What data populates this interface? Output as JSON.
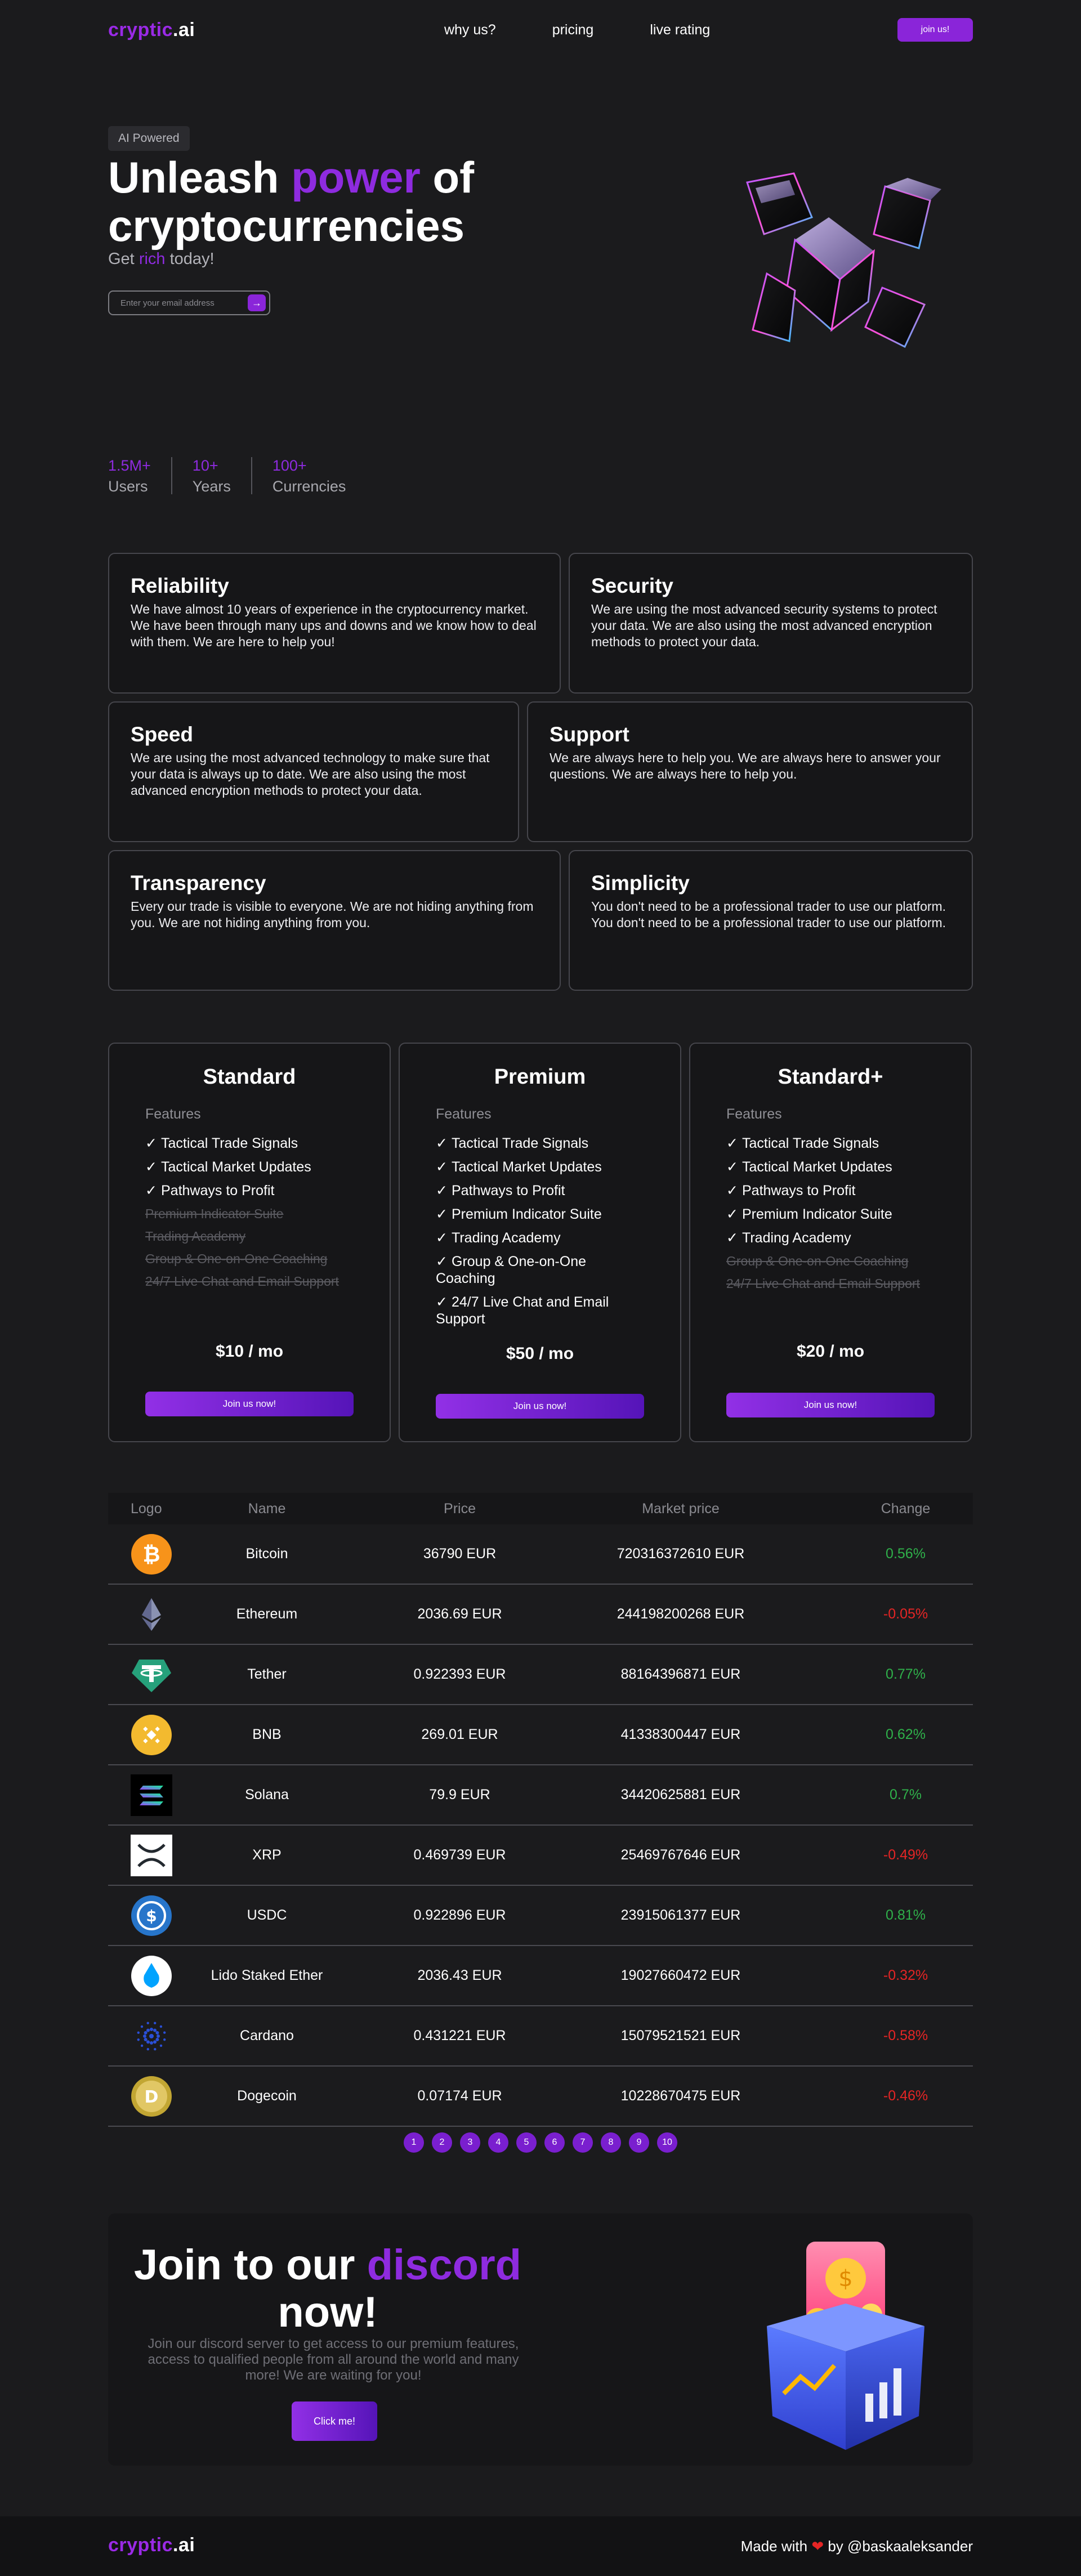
{
  "nav": {
    "logo_part1": "cryptic",
    "logo_part2": ".ai",
    "links": [
      "why us?",
      "pricing",
      "live rating"
    ],
    "join_label": "join us!"
  },
  "hero": {
    "badge": "AI Powered",
    "title_pre": "Unleash ",
    "title_accent": "power",
    "title_post": " of cryptocurrencies",
    "subtitle_pre": "Get ",
    "subtitle_accent": "rich",
    "subtitle_post": " today!",
    "email_placeholder": "Enter your email address",
    "stats": [
      {
        "value": "1.5M+",
        "label": "Users"
      },
      {
        "value": "10+",
        "label": "Years"
      },
      {
        "value": "100+",
        "label": "Currencies"
      }
    ]
  },
  "features": [
    {
      "title": "Reliability",
      "text": "We have almost 10 years of experience in the cryptocurrency market. We have been through many ups and downs and we know how to deal with them. We are here to help you!"
    },
    {
      "title": "Security",
      "text": "We are using the most advanced security systems to protect your data. We are also using the most advanced encryption methods to protect your data."
    },
    {
      "title": "Speed",
      "text": "We are using the most advanced technology to make sure that your data is always up to date. We are also using the most advanced encryption methods to protect your data."
    },
    {
      "title": "Support",
      "text": "We are always here to help you. We are always here to answer your questions. We are always here to help you."
    },
    {
      "title": "Transparency",
      "text": "Every our trade is visible to everyone. We are not hiding anything from you. We are not hiding anything from you."
    },
    {
      "title": "Simplicity",
      "text": "You don't need to be a professional trader to use our platform. You don't need to be a professional trader to use our platform."
    }
  ],
  "pricing": {
    "features_label": "Features",
    "plans": [
      {
        "name": "Standard",
        "price": "$10 / mo",
        "button": "Join us now!",
        "items": [
          {
            "text": "Tactical Trade Signals",
            "included": true
          },
          {
            "text": "Tactical Market Updates",
            "included": true
          },
          {
            "text": "Pathways to Profit",
            "included": true
          },
          {
            "text": "Premium Indicator Suite",
            "included": false
          },
          {
            "text": "Trading Academy",
            "included": false
          },
          {
            "text": "Group & One-on-One Coaching",
            "included": false
          },
          {
            "text": "24/7 Live Chat and Email Support",
            "included": false
          }
        ]
      },
      {
        "name": "Premium",
        "price": "$50 / mo",
        "button": "Join us now!",
        "items": [
          {
            "text": "Tactical Trade Signals",
            "included": true
          },
          {
            "text": "Tactical Market Updates",
            "included": true
          },
          {
            "text": "Pathways to Profit",
            "included": true
          },
          {
            "text": "Premium Indicator Suite",
            "included": true
          },
          {
            "text": "Trading Academy",
            "included": true
          },
          {
            "text": "Group & One-on-One Coaching",
            "included": true
          },
          {
            "text": "24/7 Live Chat and Email Support",
            "included": true
          }
        ]
      },
      {
        "name": "Standard+",
        "price": "$20 / mo",
        "button": "Join us now!",
        "items": [
          {
            "text": "Tactical Trade Signals",
            "included": true
          },
          {
            "text": "Tactical Market Updates",
            "included": true
          },
          {
            "text": "Pathways to Profit",
            "included": true
          },
          {
            "text": "Premium Indicator Suite",
            "included": true
          },
          {
            "text": "Trading Academy",
            "included": true
          },
          {
            "text": "Group & One-on-One Coaching",
            "included": false
          },
          {
            "text": "24/7 Live Chat and Email Support",
            "included": false
          }
        ]
      }
    ]
  },
  "table": {
    "headers": [
      "Logo",
      "Name",
      "Price",
      "Market price",
      "Change"
    ],
    "rows": [
      {
        "icon": "bitcoin-icon",
        "name": "Bitcoin",
        "price": "36790 EUR",
        "market": "720316372610 EUR",
        "change": "0.56%",
        "dir": "pos"
      },
      {
        "icon": "ethereum-icon",
        "name": "Ethereum",
        "price": "2036.69 EUR",
        "market": "244198200268 EUR",
        "change": "-0.05%",
        "dir": "neg"
      },
      {
        "icon": "tether-icon",
        "name": "Tether",
        "price": "0.922393 EUR",
        "market": "88164396871 EUR",
        "change": "0.77%",
        "dir": "pos"
      },
      {
        "icon": "bnb-icon",
        "name": "BNB",
        "price": "269.01 EUR",
        "market": "41338300447 EUR",
        "change": "0.62%",
        "dir": "pos"
      },
      {
        "icon": "solana-icon",
        "name": "Solana",
        "price": "79.9 EUR",
        "market": "34420625881 EUR",
        "change": "0.7%",
        "dir": "pos"
      },
      {
        "icon": "xrp-icon",
        "name": "XRP",
        "price": "0.469739 EUR",
        "market": "25469767646 EUR",
        "change": "-0.49%",
        "dir": "neg"
      },
      {
        "icon": "usdc-icon",
        "name": "USDC",
        "price": "0.922896 EUR",
        "market": "23915061377 EUR",
        "change": "0.81%",
        "dir": "pos"
      },
      {
        "icon": "lido-icon",
        "name": "Lido Staked Ether",
        "price": "2036.43 EUR",
        "market": "19027660472 EUR",
        "change": "-0.32%",
        "dir": "neg"
      },
      {
        "icon": "cardano-icon",
        "name": "Cardano",
        "price": "0.431221 EUR",
        "market": "15079521521 EUR",
        "change": "-0.58%",
        "dir": "neg"
      },
      {
        "icon": "dogecoin-icon",
        "name": "Dogecoin",
        "price": "0.07174 EUR",
        "market": "10228670475 EUR",
        "change": "-0.46%",
        "dir": "neg"
      }
    ],
    "pages": [
      "1",
      "2",
      "3",
      "4",
      "5",
      "6",
      "7",
      "8",
      "9",
      "10"
    ]
  },
  "discord": {
    "title_pre": "Join to our ",
    "title_accent": "discord",
    "title_post": " now!",
    "text": "Join our discord server to get access to our premium features, access to qualified people from all around the world and many more! We are waiting for you!",
    "button": "Click me!"
  },
  "footer": {
    "logo_part1": "cryptic",
    "logo_part2": ".ai",
    "made_pre": "Made with",
    "made_post": "by @baskaaleksander"
  },
  "colors": {
    "accent": "#8e2bdf",
    "background": "#1b1b1d",
    "positive": "#2fb04a",
    "negative": "#e52525"
  }
}
